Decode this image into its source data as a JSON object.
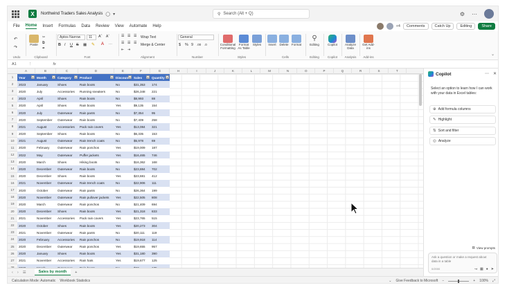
{
  "titlebar": {
    "doc_title": "Northwind Traders Sales Analysis",
    "search_placeholder": "Search (Alt + Q)"
  },
  "menu": {
    "items": [
      "File",
      "Home",
      "Insert",
      "Formulas",
      "Data",
      "Review",
      "View",
      "Automate",
      "Help"
    ],
    "active": "Home",
    "collab_count": "+4",
    "comments": "Comments",
    "catchup": "Catch Up",
    "editing": "Editing",
    "share": "Share"
  },
  "ribbon": {
    "groups": {
      "undo": "Undo",
      "clipboard": "Clipboard",
      "font": "Font",
      "alignment": "Alignment",
      "number": "Number",
      "styles": "Styles",
      "cells": "Cells",
      "editing": "Editing",
      "copilot": "Copilot",
      "analysis": "Analysis",
      "addins": "Add-ins"
    },
    "paste": "Paste",
    "font_name": "Aptos Narrow",
    "font_size": "11",
    "wrap_text": "Wrap Text",
    "merge_center": "Merge & Center",
    "number_format": "General",
    "conditional_formatting": "Conditional Formatting",
    "format_as_table": "Format As Table",
    "styles_btn": "Styles",
    "insert": "Insert",
    "delete": "Delete",
    "format": "Format",
    "editing_btn": "Editing",
    "copilot_btn": "Copilot",
    "analyze_data": "Analyze Data",
    "get_addins": "Get Add-ins"
  },
  "formulabar": {
    "namebox": "A1",
    "fx": "fx"
  },
  "grid": {
    "columns": [
      "A",
      "B",
      "C",
      "D",
      "E",
      "F",
      "G",
      "H",
      "I",
      "J",
      "K",
      "L",
      "M",
      "N",
      "O",
      "P",
      "Q",
      "R",
      "S",
      "T"
    ],
    "row_numbers": [
      "1",
      "2",
      "3",
      "4",
      "5",
      "6",
      "7",
      "8",
      "9",
      "10",
      "11",
      "12",
      "13",
      "14",
      "15",
      "16",
      "17",
      "18",
      "19",
      "20",
      "21",
      "22",
      "23",
      "24",
      "25",
      "26",
      "27",
      "28"
    ],
    "headers": [
      "Year",
      "Month",
      "Category",
      "Product",
      "Discount",
      "Sales",
      "Quantity"
    ],
    "rows": [
      [
        "2023",
        "January",
        "Shoes",
        "Rain boots",
        "No",
        "$31,353",
        "174"
      ],
      [
        "2020",
        "July",
        "Accessories",
        "Running sneakers",
        "No",
        "$26,348",
        "221"
      ],
      [
        "2023",
        "April",
        "Shoes",
        "Rain boots",
        "No",
        "$8,993",
        "88"
      ],
      [
        "2020",
        "April",
        "Shoes",
        "Rain boots",
        "Yes",
        "$9,135",
        "154"
      ],
      [
        "2020",
        "July",
        "Outerwear",
        "Rain pants",
        "No",
        "$7,354",
        "95"
      ],
      [
        "2020",
        "September",
        "Outerwear",
        "Rain boots",
        "No",
        "$7,409",
        "258"
      ],
      [
        "2021",
        "August",
        "Accessories",
        "Pack rain covers",
        "Yes",
        "$13,084",
        "321"
      ],
      [
        "2020",
        "September",
        "Shoes",
        "Rain boots",
        "No",
        "$6,335",
        "153"
      ],
      [
        "2021",
        "August",
        "Outerwear",
        "Rain trench coats",
        "No",
        "$5,978",
        "69"
      ],
      [
        "2020",
        "February",
        "Outerwear",
        "Rain ponchos",
        "Yes",
        "$19,009",
        "187"
      ],
      [
        "2022",
        "May",
        "Outerwear",
        "Puffer jackets",
        "Yes",
        "$16,465",
        "746"
      ],
      [
        "2020",
        "March",
        "Shoes",
        "Hiking boots",
        "No",
        "$16,362",
        "168"
      ],
      [
        "2020",
        "December",
        "Outerwear",
        "Rain boots",
        "No",
        "$23,884",
        "702"
      ],
      [
        "2020",
        "December",
        "Shoes",
        "Rain boots",
        "Yes",
        "$23,681",
        "412"
      ],
      [
        "2021",
        "November",
        "Outerwear",
        "Rain trench coats",
        "No",
        "$22,906",
        "111"
      ],
      [
        "2020",
        "October",
        "Outerwear",
        "Rain pants",
        "No",
        "$26,364",
        "199"
      ],
      [
        "2020",
        "November",
        "Outerwear",
        "Rain pullover jackets",
        "Yes",
        "$22,505",
        "808"
      ],
      [
        "2020",
        "March",
        "Outerwear",
        "Rain ponchos",
        "No",
        "$21,409",
        "694"
      ],
      [
        "2020",
        "December",
        "Shoes",
        "Rain boots",
        "Yes",
        "$21,318",
        "833"
      ],
      [
        "2021",
        "November",
        "Accessories",
        "Pack rain covers",
        "Yes",
        "$23,765",
        "515"
      ],
      [
        "2020",
        "October",
        "Shoes",
        "Rain boots",
        "Yes",
        "$20,273",
        "304"
      ],
      [
        "2021",
        "November",
        "Outerwear",
        "Rain pants",
        "No",
        "$20,111",
        "119"
      ],
      [
        "2020",
        "February",
        "Accessories",
        "Rain ponchos",
        "No",
        "$19,918",
        "114"
      ],
      [
        "2020",
        "December",
        "Outerwear",
        "Rain ponchos",
        "Yes",
        "$19,655",
        "957"
      ],
      [
        "2020",
        "January",
        "Shoes",
        "Rain boots",
        "Yes",
        "$31,180",
        "390"
      ],
      [
        "2021",
        "November",
        "Accessories",
        "Rain hats",
        "Yes",
        "$19,677",
        "125"
      ]
    ],
    "row_27_partial": [
      "2020",
      "March",
      "Outerwear",
      "Rain boots",
      "No",
      "$23,...",
      "175"
    ]
  },
  "sheettabs": {
    "active": "Sales by month",
    "add": "+"
  },
  "statusbar": {
    "calc_mode": "Calculation Mode: Automatic",
    "workbook_stats": "Workbook Statistics",
    "feedback": "Give Feedback to Microsoft",
    "zoom": "100%"
  },
  "copilot": {
    "title": "Copilot",
    "intro": "Select an option to learn how I can work with your data in Excel tables:",
    "options": [
      "Add formula columns",
      "Highlight",
      "Sort and filter",
      "Analyze"
    ],
    "view_prompts": "View prompts",
    "input_placeholder": "Ask a question or make a request about data in a table",
    "char_count": "0/2000"
  },
  "colors": {
    "brand_green": "#107c41",
    "table_header": "#4472c4",
    "table_band": "#d9e1f2"
  }
}
